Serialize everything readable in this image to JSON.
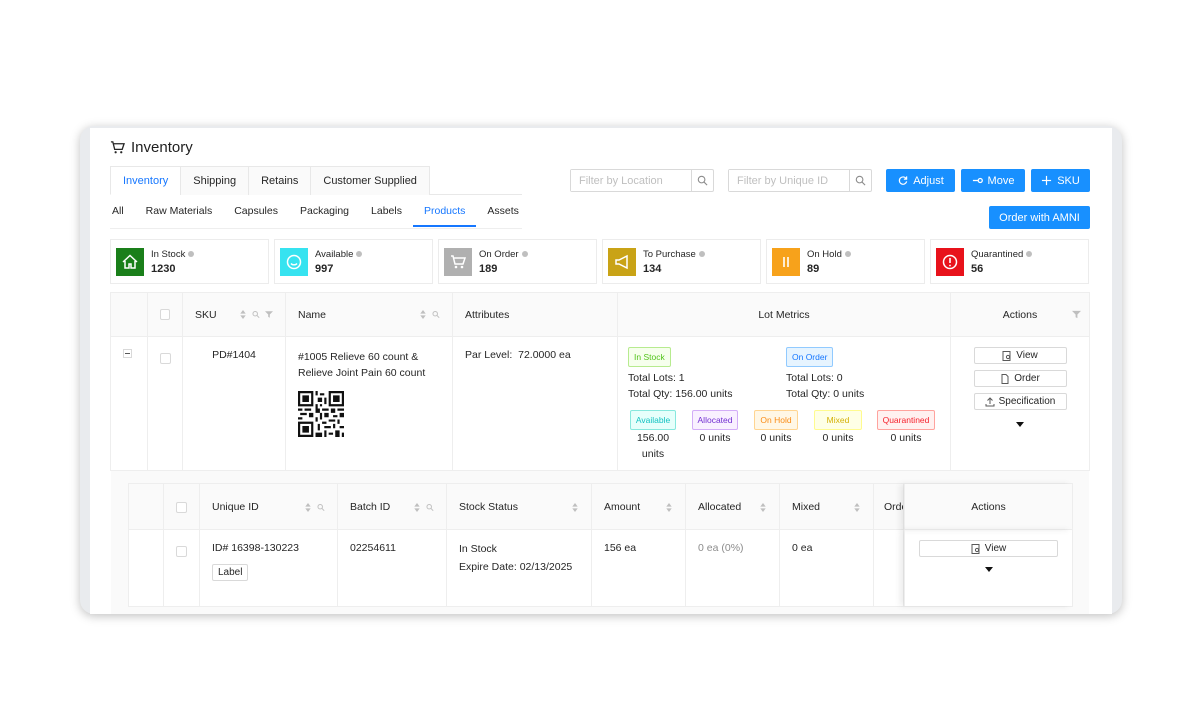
{
  "app": {
    "title": "Inventory"
  },
  "main_tabs": [
    {
      "label": "Inventory",
      "active": true
    },
    {
      "label": "Shipping",
      "active": false
    },
    {
      "label": "Retains",
      "active": false
    },
    {
      "label": "Customer Supplied",
      "active": false
    }
  ],
  "filters": {
    "location_placeholder": "Filter by Location",
    "unique_id_placeholder": "Filter by Unique ID"
  },
  "toolbar": {
    "adjust_label": "Adjust",
    "move_label": "Move",
    "sku_label": "SKU",
    "order_amni_label": "Order with AMNI"
  },
  "sub_tabs": [
    {
      "label": "All",
      "active": false
    },
    {
      "label": "Raw Materials",
      "active": false
    },
    {
      "label": "Capsules",
      "active": false
    },
    {
      "label": "Packaging",
      "active": false
    },
    {
      "label": "Labels",
      "active": false
    },
    {
      "label": "Products",
      "active": true
    },
    {
      "label": "Assets",
      "active": false
    }
  ],
  "stats": [
    {
      "label": "In Stock",
      "value": "1230",
      "color": "#1a7f1a",
      "icon": "home-icon"
    },
    {
      "label": "Available",
      "value": "997",
      "color": "#36e3f0",
      "icon": "smile-icon"
    },
    {
      "label": "On Order",
      "value": "189",
      "color": "#b0b0b0",
      "icon": "cart-icon"
    },
    {
      "label": "To Purchase",
      "value": "134",
      "color": "#c9a316",
      "icon": "megaphone-icon"
    },
    {
      "label": "On Hold",
      "value": "89",
      "color": "#f7a21b",
      "icon": "pause-icon"
    },
    {
      "label": "Quarantined",
      "value": "56",
      "color": "#e8121b",
      "icon": "alert-icon"
    }
  ],
  "products_table": {
    "headers": {
      "sku": "SKU",
      "name": "Name",
      "attributes": "Attributes",
      "lot_metrics": "Lot Metrics",
      "actions": "Actions"
    },
    "row": {
      "sku": "PD#1404",
      "name_line1": "#1005 Relieve 60 count &",
      "name_line2": "Relieve Joint Pain 60 count",
      "par_level_label": "Par Level:",
      "par_level_value": "72.0000 ea",
      "in_stock_tag": "In Stock",
      "in_stock_lots": "Total Lots:  1",
      "in_stock_qty": "Total Qty:  156.00 units",
      "on_order_tag": "On Order",
      "on_order_lots": "Total Lots:  0",
      "on_order_qty": "Total Qty:  0 units",
      "breakdown": [
        {
          "tag": "Available",
          "value": "156.00",
          "value2": "units"
        },
        {
          "tag": "Allocated",
          "value": "0 units"
        },
        {
          "tag": "On Hold",
          "value": "0 units"
        },
        {
          "tag": "Mixed",
          "value": "0 units"
        },
        {
          "tag": "Quarantined",
          "value": "0 units"
        }
      ],
      "actions": {
        "view": "View",
        "order": "Order",
        "specification": "Specification"
      }
    }
  },
  "lots_table": {
    "headers": {
      "unique_id": "Unique ID",
      "batch_id": "Batch ID",
      "stock_status": "Stock Status",
      "amount": "Amount",
      "allocated": "Allocated",
      "mixed": "Mixed",
      "order": "Orde",
      "actions": "Actions"
    },
    "row": {
      "unique_id": "ID# 16398-130223",
      "label_button": "Label",
      "batch_id": "02254611",
      "stock_status": "In Stock",
      "expire_date": "Expire Date: 02/13/2025",
      "amount": "156 ea",
      "allocated": "0 ea (0%)",
      "mixed": "0 ea",
      "view": "View"
    }
  }
}
